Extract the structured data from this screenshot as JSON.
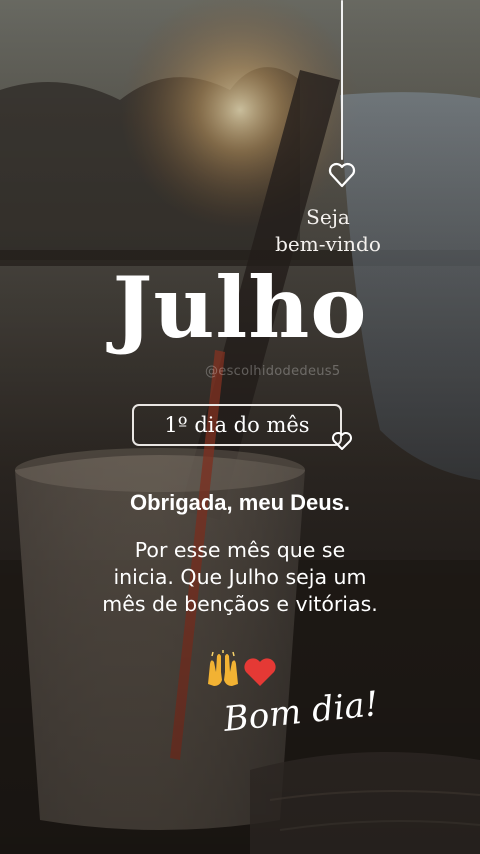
{
  "background": {
    "description_icon": "sunset-glass-photo-icon",
    "colors": {
      "sky": "#6b6960",
      "sun": "#f6d79c",
      "ground": "#3b3128",
      "glass": "#8d7f73",
      "straw": "#b2432c"
    }
  },
  "header": {
    "welcome_line1": "Seja",
    "welcome_line2": "bem-vindo"
  },
  "title": {
    "month": "Julho",
    "watermark": "@escolhidodedeus5"
  },
  "badge": {
    "label": "1º dia do mês"
  },
  "body": {
    "thanks": "Obrigada, meu Deus.",
    "line1": "Por esse mês que se",
    "line2": "inicia. Que Julho seja um",
    "line3": "mês de bençãos e vitórias."
  },
  "emojis": [
    "praise-hands-icon",
    "red-heart-icon"
  ],
  "signoff": "Bom dia!",
  "accent_colors": {
    "heart": "#e53935",
    "hands": "#f2b233"
  }
}
